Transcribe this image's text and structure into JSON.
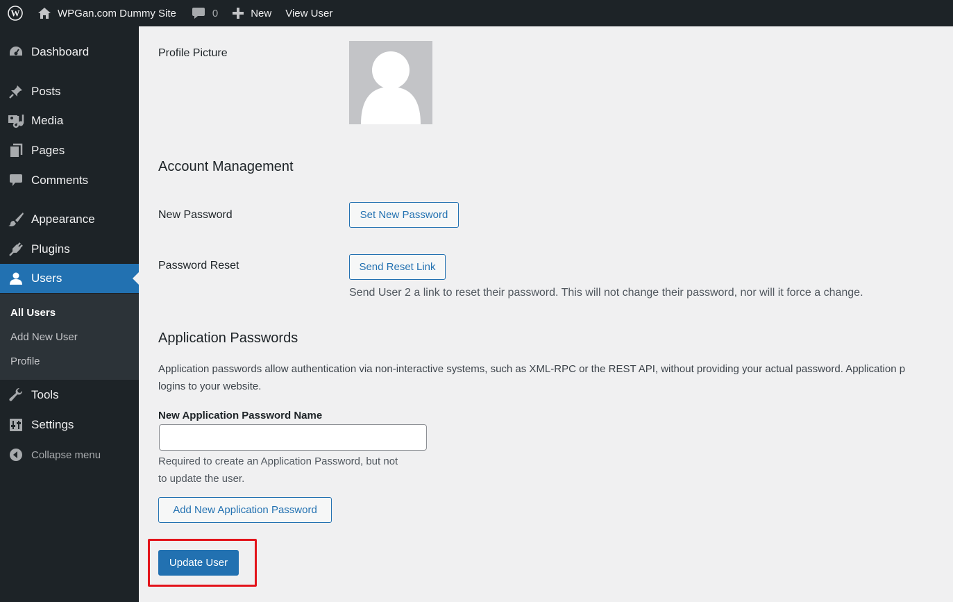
{
  "admin_bar": {
    "site_name": "WPGan.com Dummy Site",
    "comment_count": "0",
    "new_label": "New",
    "view_user_label": "View User"
  },
  "sidebar": {
    "items": [
      {
        "label": "Dashboard",
        "icon": "dashboard-icon"
      },
      {
        "label": "Posts",
        "icon": "pin-icon"
      },
      {
        "label": "Media",
        "icon": "media-icon"
      },
      {
        "label": "Pages",
        "icon": "pages-icon"
      },
      {
        "label": "Comments",
        "icon": "comments-icon"
      },
      {
        "label": "Appearance",
        "icon": "brush-icon"
      },
      {
        "label": "Plugins",
        "icon": "plug-icon"
      },
      {
        "label": "Users",
        "icon": "user-icon"
      },
      {
        "label": "Tools",
        "icon": "wrench-icon"
      },
      {
        "label": "Settings",
        "icon": "settings-icon"
      }
    ],
    "users_submenu": [
      "All Users",
      "Add New User",
      "Profile"
    ],
    "collapse_label": "Collapse menu"
  },
  "content": {
    "profile_picture_label": "Profile Picture",
    "account_management_heading": "Account Management",
    "new_password_label": "New Password",
    "set_new_password_button": "Set New Password",
    "password_reset_label": "Password Reset",
    "send_reset_link_button": "Send Reset Link",
    "reset_description": "Send User 2 a link to reset their password. This will not change their password, nor will it force a change.",
    "app_passwords_heading": "Application Passwords",
    "app_passwords_description_line1": "Application passwords allow authentication via non-interactive systems, such as XML-RPC or the REST API, without providing your actual password. Application p",
    "app_passwords_description_line2": "logins to your website.",
    "new_app_password_name_label": "New Application Password Name",
    "new_app_password_name_value": "",
    "new_app_password_help_line1": "Required to create an Application Password, but not",
    "new_app_password_help_line2": "to update the user.",
    "add_app_password_button": "Add New Application Password",
    "update_user_button": "Update User"
  },
  "colors": {
    "adminbar_bg": "#1d2327",
    "sidebar_bg": "#1d2327",
    "submenu_bg": "#2c3338",
    "accent": "#2271b1",
    "highlight": "#e3141b",
    "content_bg": "#f0f0f1"
  }
}
